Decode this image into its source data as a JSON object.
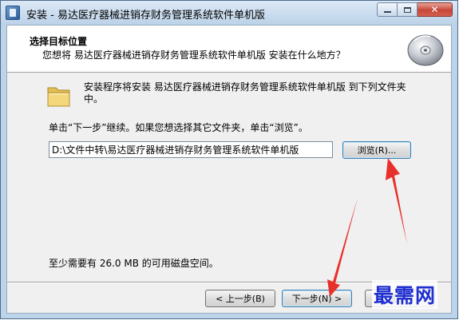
{
  "window": {
    "title": "安装 - 易达医疗器械进销存财务管理系统软件单机版",
    "icon": "installer-app-icon",
    "controls": [
      "minimize-icon",
      "maximize-icon",
      "close-icon"
    ],
    "close_glyph": "✕"
  },
  "header": {
    "title": "选择目标位置",
    "subtitle": "您想将 易达医疗器械进销存财务管理系统软件单机版 安装在什么地方？",
    "icon": "disc-icon"
  },
  "body": {
    "folder_icon": "folder-icon",
    "install_text": "安装程序将安装 易达医疗器械进销存财务管理系统软件单机版 到下列文件夹中。",
    "instruction": "单击“下一步”继续。如果您想选择其它文件夹，单击“浏览”。",
    "path_value": "D:\\文件中转\\易达医疗器械进销存财务管理系统软件单机版",
    "browse_label": "浏览(R)...",
    "space_required": "至少需要有 26.0 MB 的可用磁盘空间。"
  },
  "footer": {
    "back_label": "< 上一步(B)",
    "next_label": "下一步(N) >",
    "cancel_label": "取消"
  },
  "watermark": "最需网",
  "colors": {
    "arrow": "#e8302a",
    "watermark": "#1f2fd0",
    "focus_border": "#3c7fb1"
  }
}
